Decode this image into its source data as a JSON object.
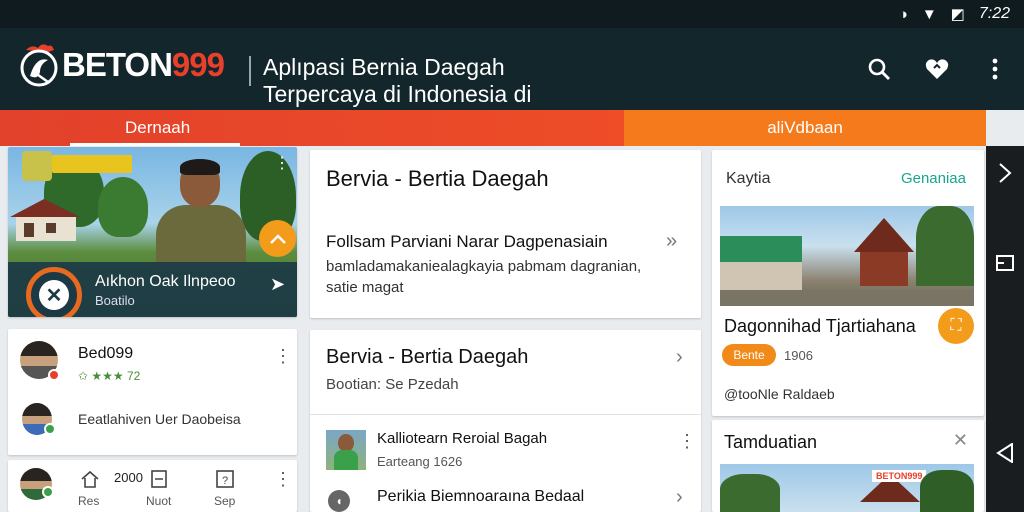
{
  "status": {
    "time": "7:22",
    "icons": [
      "sync-icon",
      "wifi-icon",
      "battery-icon"
    ]
  },
  "header": {
    "logo_text": "BETON",
    "logo_num": "999",
    "tagline": "Aplıpasi Bernia Daegah Terpercaya di Indonesia di",
    "actions": [
      "search-icon",
      "heart-icon",
      "more-icon"
    ]
  },
  "tabs": [
    {
      "label": "Dernaah",
      "active": true
    },
    {
      "label": "aliVdbaan",
      "active": false
    }
  ],
  "hero": {
    "title": "Aıkhon Oak Ilnpeoo",
    "subtitle": "Boatilo"
  },
  "left_cards": {
    "profile": {
      "name": "Bed099",
      "rating": "✩ ★★★ 72"
    },
    "comment": {
      "text": "Eeatlahiven Uer Daobeisa"
    },
    "bottom": {
      "count": "2000",
      "items": [
        {
          "label": "Res"
        },
        {
          "label": "Nuot"
        },
        {
          "label": "Sep"
        }
      ]
    }
  },
  "middle": {
    "featured": {
      "title": "Bervia - Bertia Daegah",
      "headline": "Follsam Parviani Narar Dagpenasiain",
      "body": "bamladamakaniealagkayia pabmam dagranian, satie magat"
    },
    "list": {
      "title": "Bervia - Bertia Daegah",
      "subtitle": "Bootian: Se Pzedah",
      "item1_title": "Kalliotearn Reroial Bagah",
      "item1_meta": "Earteang  1626",
      "item2_title": "Perikia Biemnoaraına Bedaal"
    }
  },
  "right": {
    "card1": {
      "label_left": "Kaytia",
      "label_right": "Genaniaa",
      "title": "Dagonnihad Tjartiahana",
      "pill": "Bente",
      "year": "1906",
      "footer": "@tooNle Raldaeb"
    },
    "card2": {
      "title": "Tamduatian",
      "photo_label": "BETON999"
    }
  },
  "colors": {
    "red": "#e2412b",
    "orange": "#f47a1c",
    "dark": "#13262c",
    "teal": "#1c3a46"
  }
}
